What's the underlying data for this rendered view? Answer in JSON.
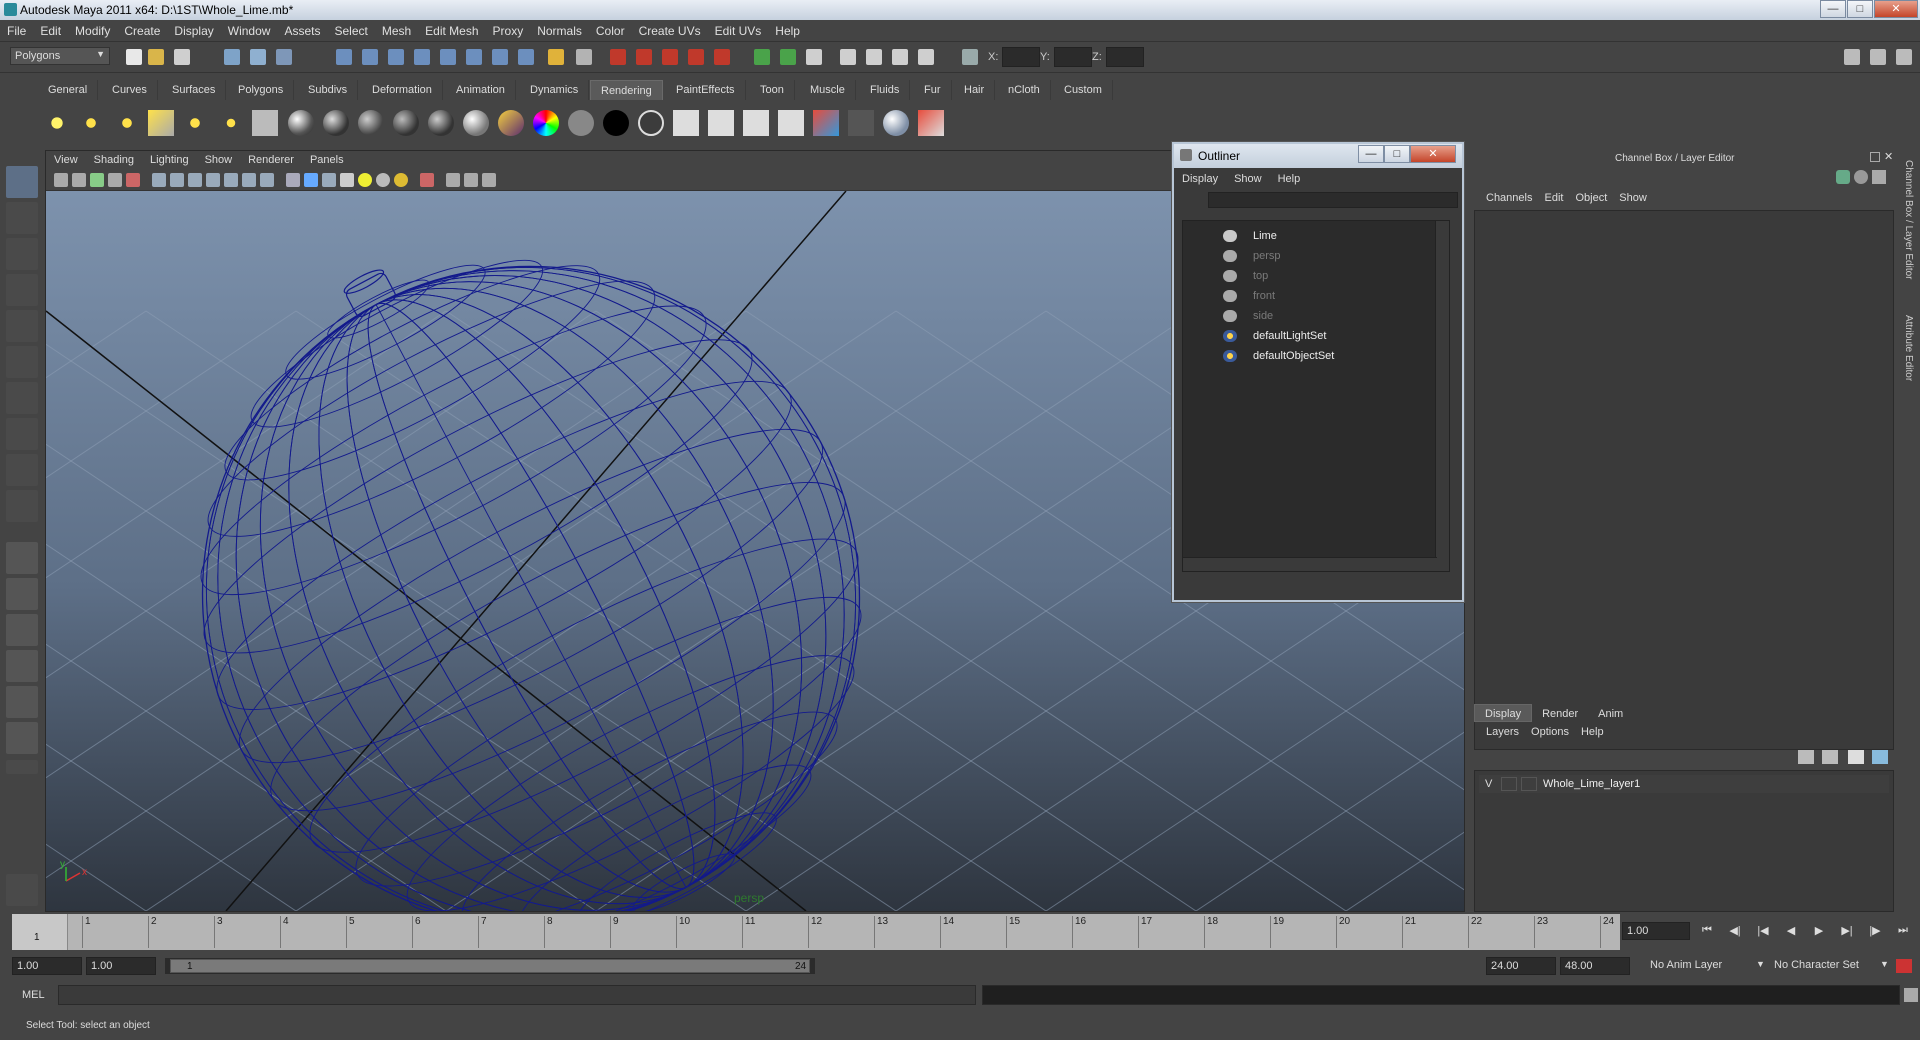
{
  "window": {
    "title": "Autodesk Maya 2011 x64: D:\\1ST\\Whole_Lime.mb*"
  },
  "menubar": [
    "File",
    "Edit",
    "Modify",
    "Create",
    "Display",
    "Window",
    "Assets",
    "Select",
    "Mesh",
    "Edit Mesh",
    "Proxy",
    "Normals",
    "Color",
    "Create UVs",
    "Edit UVs",
    "Help"
  ],
  "statusline": {
    "mode": "Polygons",
    "x_label": "X:",
    "y_label": "Y:",
    "z_label": "Z:"
  },
  "shelf": {
    "tabs": [
      "General",
      "Curves",
      "Surfaces",
      "Polygons",
      "Subdivs",
      "Deformation",
      "Animation",
      "Dynamics",
      "Rendering",
      "PaintEffects",
      "Toon",
      "Muscle",
      "Fluids",
      "Fur",
      "Hair",
      "nCloth",
      "Custom"
    ],
    "active_tab": "Rendering"
  },
  "viewport": {
    "menu": [
      "View",
      "Shading",
      "Lighting",
      "Show",
      "Renderer",
      "Panels"
    ],
    "camera_label": "persp",
    "wire_color": "#131a8c",
    "axis_x": "x",
    "axis_y": "y"
  },
  "outliner": {
    "title": "Outliner",
    "menu": [
      "Display",
      "Show",
      "Help"
    ],
    "items": [
      {
        "label": "Lime",
        "icon": "transform-icon",
        "dimmed": false
      },
      {
        "label": "persp",
        "icon": "camera-icon",
        "dimmed": true
      },
      {
        "label": "top",
        "icon": "camera-icon",
        "dimmed": true
      },
      {
        "label": "front",
        "icon": "camera-icon",
        "dimmed": true
      },
      {
        "label": "side",
        "icon": "camera-icon",
        "dimmed": true
      },
      {
        "label": "defaultLightSet",
        "icon": "set-icon",
        "dimmed": false
      },
      {
        "label": "defaultObjectSet",
        "icon": "set-icon",
        "dimmed": false
      }
    ]
  },
  "channelbox": {
    "title": "Channel Box / Layer Editor",
    "menu": [
      "Channels",
      "Edit",
      "Object",
      "Show"
    ],
    "side_tabs": [
      "Channel Box / Layer Editor",
      "Attribute Editor"
    ]
  },
  "layer_editor": {
    "tabs": [
      "Display",
      "Render",
      "Anim"
    ],
    "active_tab": "Display",
    "menu": [
      "Layers",
      "Options",
      "Help"
    ],
    "layers": [
      {
        "visible": "V",
        "name": "Whole_Lime_layer1"
      }
    ]
  },
  "timeslider": {
    "frames": [
      "1",
      "2",
      "3",
      "4",
      "5",
      "6",
      "7",
      "8",
      "9",
      "10",
      "11",
      "12",
      "13",
      "14",
      "15",
      "16",
      "17",
      "18",
      "19",
      "20",
      "21",
      "22",
      "23",
      "24"
    ],
    "current_frame": "1",
    "current_time": "1.00"
  },
  "rangebar": {
    "anim_start": "1.00",
    "playback_start": "1.00",
    "range_start": "1",
    "range_end": "24",
    "playback_end": "24.00",
    "anim_end": "48.00",
    "anim_layer": "No Anim Layer",
    "character_set": "No Character Set"
  },
  "cmdline": {
    "label": "MEL"
  },
  "helpline": {
    "text": "Select Tool: select an object"
  }
}
